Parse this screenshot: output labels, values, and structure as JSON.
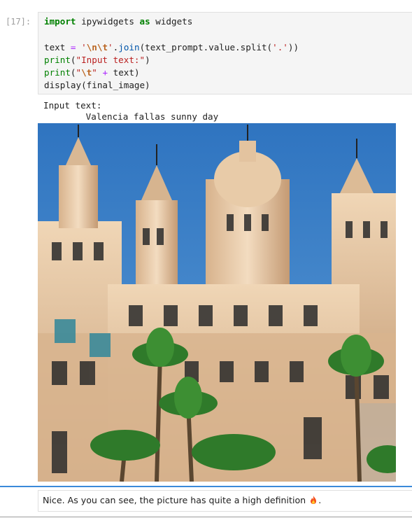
{
  "cell": {
    "prompt": "[17]:",
    "code": {
      "line1": {
        "kw1": "import",
        "mid": " ipywidgets ",
        "kw2": "as",
        "end": " widgets"
      },
      "line3": {
        "a": "text ",
        "eq": "=",
        "sp": " ",
        "s1": "'",
        "esc1": "\\n\\t",
        "s2": "'",
        "b": ".",
        "join": "join",
        "c": "(text_prompt.value.split(",
        "s3": "'.'",
        "d": "))"
      },
      "line4": {
        "fn": "print",
        "a": "(",
        "s": "\"Input text:\"",
        "b": ")"
      },
      "line5": {
        "fn": "print",
        "a": "(",
        "s1": "\"",
        "esc": "\\t",
        "s2": "\"",
        "plus": " + ",
        "b": "text)"
      },
      "line6": {
        "a": "display(final_image)"
      }
    }
  },
  "output": {
    "line1": "Input text:",
    "line2": "\tValencia fallas sunny day"
  },
  "image": {
    "subject": "generated-image-baroque-building",
    "sky_color": "#3f86c9",
    "stone_color": "#e6c8a4"
  },
  "markdown": {
    "text": "Nice. As you can see, the picture has quite a high definition",
    "emoji_icon": "fire-icon",
    "end": "."
  },
  "colors": {
    "selection_bar": "#1976d2",
    "code_bg": "#f5f5f5"
  }
}
